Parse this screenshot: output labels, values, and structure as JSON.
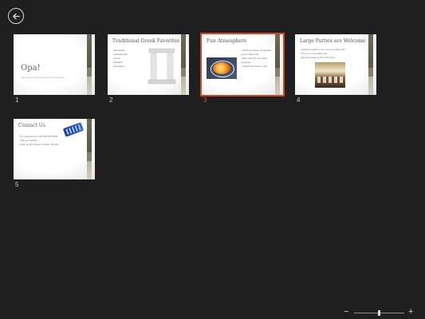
{
  "slides": [
    {
      "number": "1",
      "title": "Opa!",
      "subtitle": "Welcome to a fabulous Greek Restaurant"
    },
    {
      "number": "2",
      "title": "Traditional Greek Favorites",
      "bullets": [
        "Moussaka",
        "Spanakopita",
        "Gyros",
        "Baklava",
        "Dolmades"
      ]
    },
    {
      "number": "3",
      "title": "Fun Atmosphere",
      "bullets": [
        "Flaming cheese (saganaki) served table side",
        "Belly dancers on Friday evenings",
        "Traditional Greek music"
      ]
    },
    {
      "number": "4",
      "title": "Large Parties are Welcome",
      "bullets": [
        "Upstairs seating room accommodates 80",
        "No room reservation fee",
        "Meeting areas by the front desk"
      ]
    },
    {
      "number": "5",
      "title": "Contact Us",
      "bullets": [
        "For reservations, call 555-555-5555",
        "Visit our website",
        "Open at 11th Street, Certain, Florida"
      ]
    }
  ],
  "selected_slide": "3",
  "zoom": {
    "out_label": "−",
    "in_label": "+",
    "level_fraction": 0.5
  },
  "colors": {
    "background": "#1f1f1f",
    "accent": "#d24726"
  },
  "icons": {
    "back": "back-arrow-icon"
  }
}
